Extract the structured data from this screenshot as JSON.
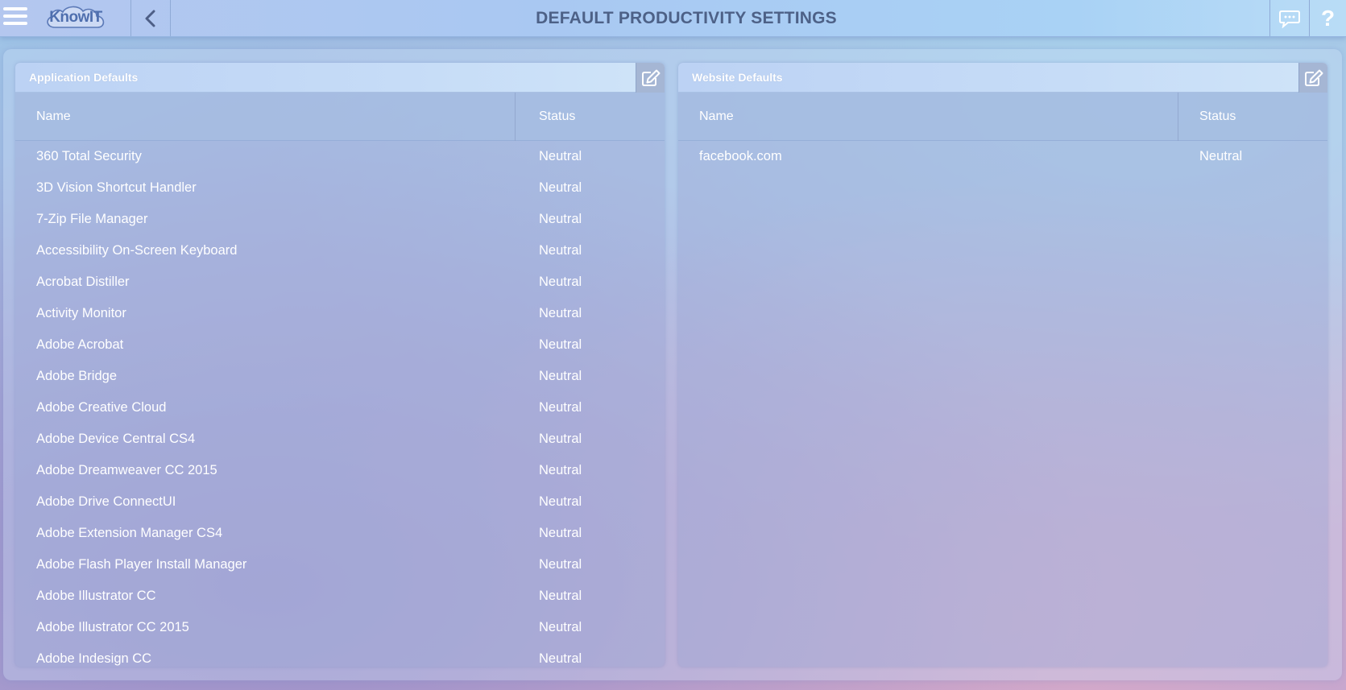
{
  "header": {
    "logo_text": "KnowIT",
    "title": "DEFAULT PRODUCTIVITY SETTINGS",
    "help_label": "?"
  },
  "application_defaults": {
    "title": "Application Defaults",
    "columns": {
      "name": "Name",
      "status": "Status"
    },
    "rows": [
      {
        "name": "360 Total Security",
        "status": "Neutral"
      },
      {
        "name": "3D Vision Shortcut Handler",
        "status": "Neutral"
      },
      {
        "name": "7-Zip File Manager",
        "status": "Neutral"
      },
      {
        "name": "Accessibility On-Screen Keyboard",
        "status": "Neutral"
      },
      {
        "name": "Acrobat Distiller",
        "status": "Neutral"
      },
      {
        "name": "Activity Monitor",
        "status": "Neutral"
      },
      {
        "name": "Adobe Acrobat",
        "status": "Neutral"
      },
      {
        "name": "Adobe Bridge",
        "status": "Neutral"
      },
      {
        "name": "Adobe Creative Cloud",
        "status": "Neutral"
      },
      {
        "name": "Adobe Device Central CS4",
        "status": "Neutral"
      },
      {
        "name": "Adobe Dreamweaver CC 2015",
        "status": "Neutral"
      },
      {
        "name": "Adobe Drive ConnectUI",
        "status": "Neutral"
      },
      {
        "name": "Adobe Extension Manager CS4",
        "status": "Neutral"
      },
      {
        "name": "Adobe Flash Player Install Manager",
        "status": "Neutral"
      },
      {
        "name": "Adobe Illustrator CC",
        "status": "Neutral"
      },
      {
        "name": "Adobe Illustrator CC 2015",
        "status": "Neutral"
      },
      {
        "name": "Adobe Indesign CC",
        "status": "Neutral"
      }
    ]
  },
  "website_defaults": {
    "title": "Website Defaults",
    "columns": {
      "name": "Name",
      "status": "Status"
    },
    "rows": [
      {
        "name": "facebook.com",
        "status": "Neutral"
      }
    ]
  },
  "icons": {
    "menu": "hamburger-icon",
    "back": "chevron-left-icon",
    "chat": "chat-bubble-icon",
    "help": "question-mark-icon",
    "edit": "edit-icon"
  },
  "colors": {
    "title_text": "#4d6187",
    "logo_text": "#4f6fae",
    "header_bar": "#a9c8f2"
  }
}
